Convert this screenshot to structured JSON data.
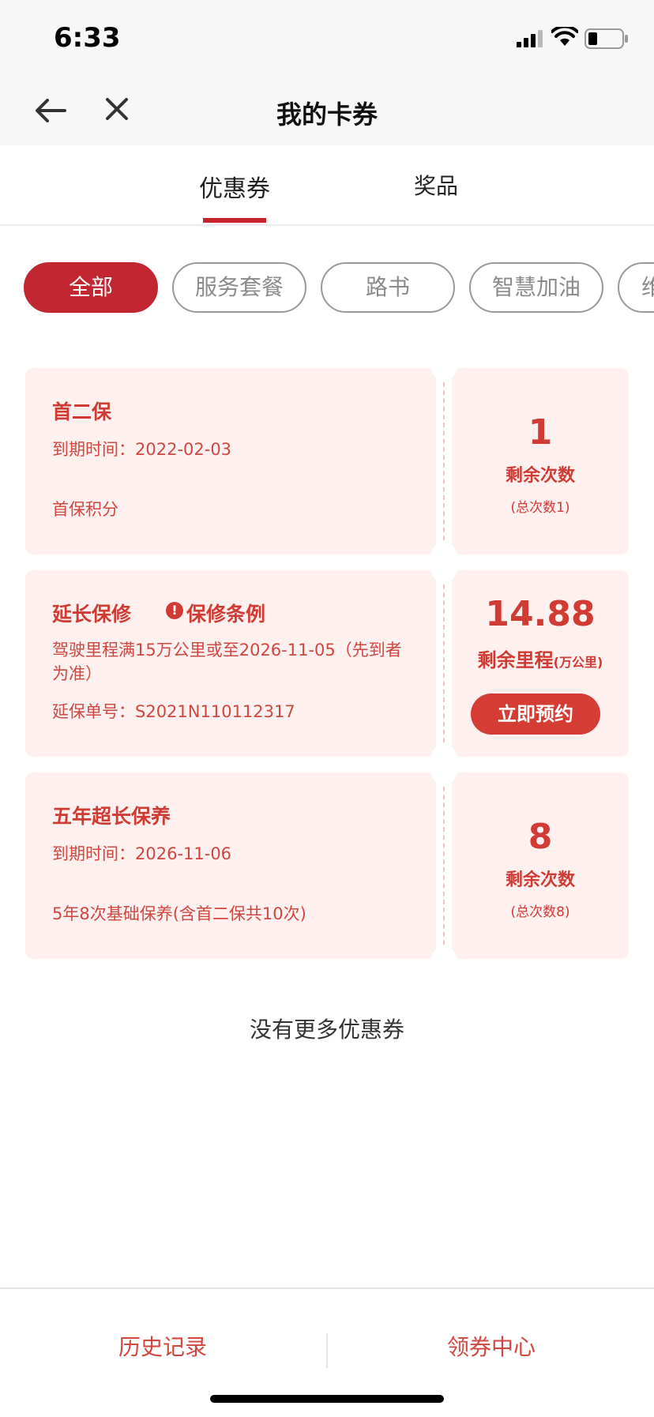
{
  "status_bar": {
    "time": "6:33"
  },
  "nav": {
    "title": "我的卡券"
  },
  "tabs": [
    {
      "label": "优惠券",
      "active": true
    },
    {
      "label": "奖品",
      "active": false
    }
  ],
  "filters": [
    {
      "label": "全部",
      "active": true
    },
    {
      "label": "服务套餐",
      "active": false
    },
    {
      "label": "路书",
      "active": false
    },
    {
      "label": "智慧加油",
      "active": false
    },
    {
      "label": "维",
      "active": false
    }
  ],
  "coupons": [
    {
      "title": "首二保",
      "line1": "到期时间：2022-02-03",
      "line2": "首保积分",
      "big_value": "1",
      "value_label": "剩余次数",
      "value_sub": "(总次数1)"
    },
    {
      "title": "延长保修",
      "link": "保修条例",
      "warn_icon": "!",
      "line1a": "驾驶里程满15万公里或至2026-11-05（先到者",
      "line1b": "为准）",
      "line2": "延保单号：S2021N110112317",
      "big_value": "14.88",
      "value_label": "剩余里程",
      "value_unit": "(万公里)",
      "button": "立即预约"
    },
    {
      "title": "五年超长保养",
      "line1": "到期时间：2026-11-06",
      "line2": "5年8次基础保养(含首二保共10次)",
      "big_value": "8",
      "value_label": "剩余次数",
      "value_sub": "(总次数8)"
    }
  ],
  "footer_note": "没有更多优惠券",
  "bottom_bar": {
    "left": "历史记录",
    "right": "领券中心"
  },
  "colors": {
    "accent": "#c22630",
    "card_bg": "#fdf0ee",
    "text_red": "#d03b33"
  }
}
